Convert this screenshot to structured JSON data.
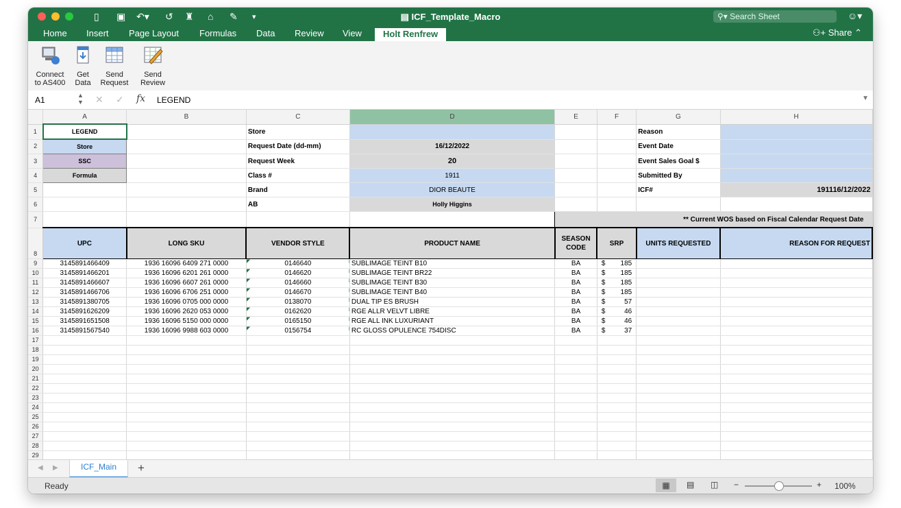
{
  "app": {
    "title": "ICF_Template_Macro",
    "search_placeholder": "Search Sheet",
    "share_label": "Share",
    "accent_color": "#217346"
  },
  "menu_tabs": [
    "Home",
    "Insert",
    "Page Layout",
    "Formulas",
    "Data",
    "Review",
    "View",
    "Holt Renfrew"
  ],
  "ribbon": {
    "connect": "Connect to AS400",
    "get_data": "Get Data",
    "send_request": "Send Request",
    "send_review": "Send Review"
  },
  "formula_bar": {
    "cell_ref": "A1",
    "fx": "fx",
    "value": "LEGEND"
  },
  "columns": [
    "A",
    "B",
    "C",
    "D",
    "E",
    "F",
    "G",
    "H"
  ],
  "legend": {
    "title": "LEGEND",
    "store": "Store",
    "ssc": "SSC",
    "formula": "Formula"
  },
  "info": {
    "store_label": "Store",
    "request_date_label": "Request Date (dd-mm)",
    "request_date": "16/12/2022",
    "request_week_label": "Request Week",
    "request_week": "20",
    "class_label": "Class #",
    "class_value": "1911",
    "brand_label": "Brand",
    "brand_value": "DIOR BEAUTE",
    "ab_label": "AB",
    "ab_value": "Holly Higgins",
    "reason_label": "Reason",
    "event_date_label": "Event Date",
    "event_sales_goal_label": "Event Sales Goal $",
    "submitted_by_label": "Submitted By",
    "icf_label": "ICF#",
    "icf_value": "191116/12/2022",
    "wos_note": "** Current WOS based on Fiscal Calendar Request Date"
  },
  "table_headers": {
    "upc": "UPC",
    "long_sku": "LONG SKU",
    "vendor_style": "VENDOR STYLE",
    "product_name": "PRODUCT NAME",
    "season_code": "SEASON CODE",
    "srp": "SRP",
    "units_requested": "UNITS REQUESTED",
    "reason_for_request": "REASON FOR REQUEST"
  },
  "rows": [
    {
      "upc": "3145891466409",
      "sku": "1936 16096 6409 271 0000",
      "style": "0146640",
      "name": "SUBLIMAGE TEINT B10",
      "season": "BA",
      "cur": "$",
      "srp": "185"
    },
    {
      "upc": "3145891466201",
      "sku": "1936 16096 6201 261 0000",
      "style": "0146620",
      "name": "SUBLIMAGE TEINT BR22",
      "season": "BA",
      "cur": "$",
      "srp": "185"
    },
    {
      "upc": "3145891466607",
      "sku": "1936 16096 6607 261 0000",
      "style": "0146660",
      "name": "SUBLIMAGE TEINT B30",
      "season": "BA",
      "cur": "$",
      "srp": "185"
    },
    {
      "upc": "3145891466706",
      "sku": "1936 16096 6706 251 0000",
      "style": "0146670",
      "name": "SUBLIMAGE TEINT B40",
      "season": "BA",
      "cur": "$",
      "srp": "185"
    },
    {
      "upc": "3145891380705",
      "sku": "1936 16096 0705 000 0000",
      "style": "0138070",
      "name": "DUAL TIP ES BRUSH",
      "season": "BA",
      "cur": "$",
      "srp": "57"
    },
    {
      "upc": "3145891626209",
      "sku": "1936 16096 2620 053 0000",
      "style": "0162620",
      "name": "RGE ALLR VELVT LIBRE",
      "season": "BA",
      "cur": "$",
      "srp": "46"
    },
    {
      "upc": "3145891651508",
      "sku": "1936 16096 5150 000 0000",
      "style": "0165150",
      "name": "RGE ALL INK LUXURIANT",
      "season": "BA",
      "cur": "$",
      "srp": "46"
    },
    {
      "upc": "3145891567540",
      "sku": "1936 16096 9988 603 0000",
      "style": "0156754",
      "name": "RC GLOSS OPULENCE 754DISC",
      "season": "BA",
      "cur": "$",
      "srp": "37"
    }
  ],
  "row_numbers": [
    "1",
    "2",
    "3",
    "4",
    "5",
    "6",
    "7",
    "8",
    "9",
    "10",
    "11",
    "12",
    "13",
    "14",
    "15",
    "16",
    "17",
    "18",
    "19",
    "20",
    "21",
    "22",
    "23",
    "24",
    "25",
    "26",
    "27",
    "28",
    "29"
  ],
  "sheet_tab": "ICF_Main",
  "add_sheet": "+",
  "status": {
    "text": "Ready",
    "zoom": "100%"
  }
}
